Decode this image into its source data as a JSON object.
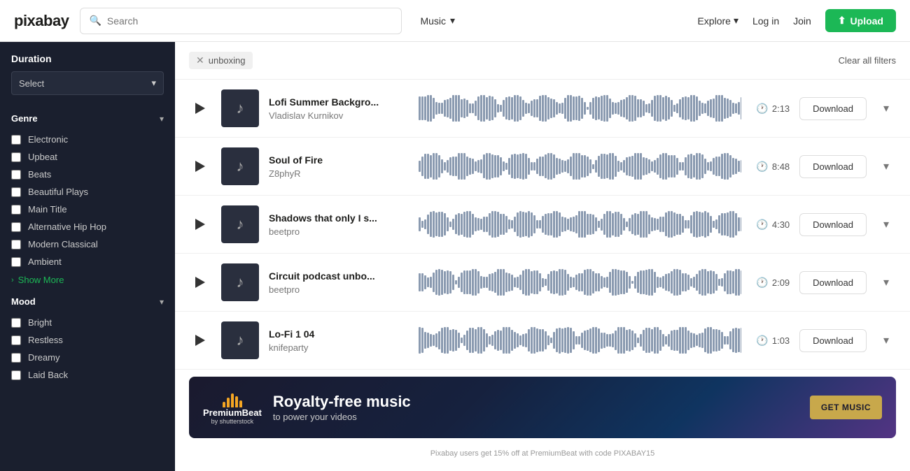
{
  "header": {
    "logo": "pixabay",
    "search_placeholder": "Search",
    "music_label": "Music",
    "explore_label": "Explore",
    "login_label": "Log in",
    "join_label": "Join",
    "upload_label": "Upload"
  },
  "filters": {
    "active_tag": "unboxing",
    "clear_label": "Clear all filters"
  },
  "sidebar": {
    "duration_title": "Duration",
    "duration_select": "Select",
    "genre_title": "Genre",
    "genre_items": [
      "Electronic",
      "Upbeat",
      "Beats",
      "Beautiful Plays",
      "Main Title",
      "Alternative Hip Hop",
      "Modern Classical",
      "Ambient"
    ],
    "show_more_label": "Show More",
    "mood_title": "Mood",
    "mood_items": [
      "Bright",
      "Restless",
      "Dreamy",
      "Laid Back"
    ]
  },
  "tracks": [
    {
      "title": "Lofi Summer Backgro...",
      "artist": "Vladislav Kurnikov",
      "duration": "2:13",
      "download_label": "Download"
    },
    {
      "title": "Soul of Fire",
      "artist": "Z8phyR",
      "duration": "8:48",
      "download_label": "Download"
    },
    {
      "title": "Shadows that only I s...",
      "artist": "beetpro",
      "duration": "4:30",
      "download_label": "Download"
    },
    {
      "title": "Circuit podcast unbo...",
      "artist": "beetpro",
      "duration": "2:09",
      "download_label": "Download"
    },
    {
      "title": "Lo-Fi 1 04",
      "artist": "knifeparty",
      "duration": "1:03",
      "download_label": "Download"
    }
  ],
  "ad": {
    "logo_main": "PremiumBeat",
    "logo_sub": "by shutterstock",
    "headline": "Royalty-free music",
    "subline": "to power your videos",
    "cta": "GET MUSIC"
  },
  "promo": "Pixabay users get 15% off at PremiumBeat with code PIXABAY15"
}
